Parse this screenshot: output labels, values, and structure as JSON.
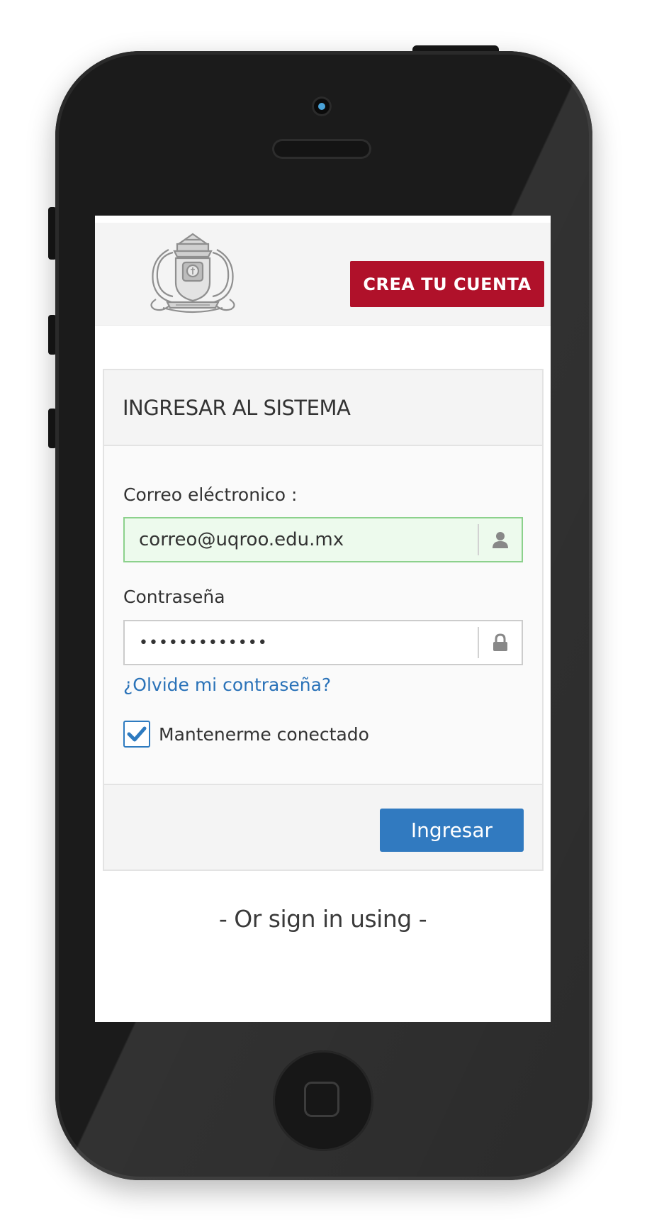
{
  "header": {
    "create_account_label": "CREA TU CUENTA",
    "logo_icon": "university-seal-logo"
  },
  "login": {
    "title": "INGRESAR AL SISTEMA",
    "email_label": "Correo eléctronico :",
    "email_value": "correo@uqroo.edu.mx",
    "email_icon": "user-icon",
    "password_label": "Contraseña",
    "password_value": "•••••••••••••",
    "password_icon": "lock-icon",
    "forgot_password": "¿Olvide mi contraseña?",
    "remember_me": "Mantenerme conectado",
    "remember_checked": true,
    "submit_label": "Ingresar"
  },
  "social": {
    "or_sign_in": "- Or sign in using -"
  },
  "colors": {
    "create_button": "#b0112a",
    "primary_button": "#317ac0",
    "link": "#2a72b8",
    "email_valid_border": "#8cd18c",
    "email_valid_bg": "#edfaed"
  }
}
